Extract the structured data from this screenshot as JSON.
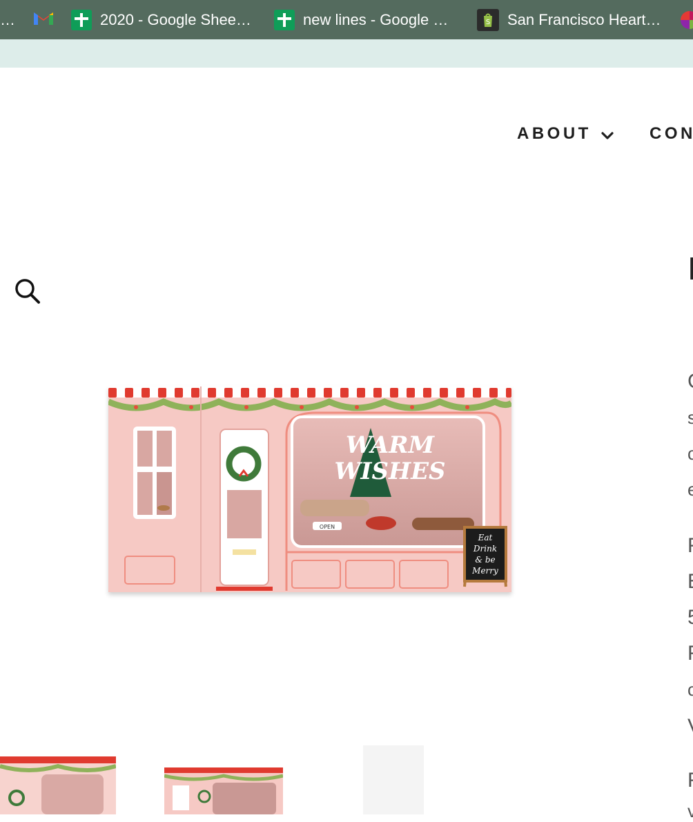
{
  "bookmarks": [
    {
      "label": "…",
      "icon": "ellipsis"
    },
    {
      "label": "",
      "icon": "gmail-icon"
    },
    {
      "label": "2020 - Google Shee…",
      "icon": "sheets-icon"
    },
    {
      "label": "new lines - Google …",
      "icon": "sheets-icon"
    },
    {
      "label": "San Francisco Heart…",
      "icon": "shopify-icon"
    },
    {
      "label": "",
      "icon": "multicolor-icon"
    }
  ],
  "nav": {
    "about_label": "ABOUT",
    "contact_label": "CON"
  },
  "product": {
    "title_fragment": "I",
    "image_sign": [
      "Eat",
      "Drink",
      "& be",
      "Merry"
    ],
    "image_window_text": [
      "WARM",
      "WISHES"
    ],
    "image_open_sign": "OPEN",
    "description_fragments": [
      "C",
      "s",
      "c",
      "e"
    ],
    "details_fragments": [
      "F",
      "E",
      "5",
      "F",
      "c",
      "V"
    ],
    "more_fragments": [
      "F",
      "v"
    ]
  },
  "colors": {
    "bookmark_bar": "#546b5e",
    "announcement": "#ddedea",
    "card_pink": "#f6c9c4"
  }
}
